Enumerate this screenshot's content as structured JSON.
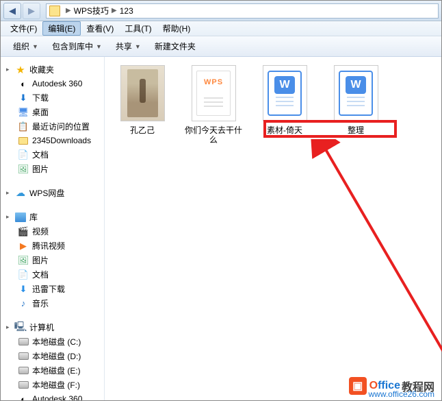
{
  "breadcrumb": {
    "part1": "WPS技巧",
    "part2": "123"
  },
  "menu": {
    "file": "文件(F)",
    "edit": "编辑(E)",
    "view": "查看(V)",
    "tools": "工具(T)",
    "help": "帮助(H)"
  },
  "toolbar": {
    "organize": "组织",
    "include": "包含到库中",
    "share": "共享",
    "newfolder": "新建文件夹"
  },
  "sidebar": {
    "favorites": {
      "label": "收藏夹",
      "items": [
        {
          "label": "Autodesk 360",
          "icon": "autodesk"
        },
        {
          "label": "下载",
          "icon": "download"
        },
        {
          "label": "桌面",
          "icon": "desktop"
        },
        {
          "label": "最近访问的位置",
          "icon": "recent"
        },
        {
          "label": "2345Downloads",
          "icon": "folder"
        },
        {
          "label": "文档",
          "icon": "document"
        },
        {
          "label": "图片",
          "icon": "picture"
        }
      ]
    },
    "wps": {
      "label": "WPS网盘"
    },
    "libraries": {
      "label": "库",
      "items": [
        {
          "label": "视频",
          "icon": "video"
        },
        {
          "label": "腾讯视频",
          "icon": "txvideo"
        },
        {
          "label": "图片",
          "icon": "picture"
        },
        {
          "label": "文档",
          "icon": "document"
        },
        {
          "label": "迅雷下载",
          "icon": "xunlei"
        },
        {
          "label": "音乐",
          "icon": "music"
        }
      ]
    },
    "computer": {
      "label": "计算机",
      "items": [
        {
          "label": "本地磁盘 (C:)"
        },
        {
          "label": "本地磁盘 (D:)"
        },
        {
          "label": "本地磁盘 (E:)"
        },
        {
          "label": "本地磁盘 (F:)"
        },
        {
          "label": "Autodesk 360"
        }
      ]
    }
  },
  "files": [
    {
      "name": "孔乙己",
      "type": "image"
    },
    {
      "name": "你们今天去干什么",
      "type": "wps"
    },
    {
      "name": "素材-倚天",
      "type": "doc"
    },
    {
      "name": "整理",
      "type": "doc"
    }
  ],
  "watermark": {
    "brand1": "Office",
    "brand2": "教程网",
    "url": "www.office26.com"
  }
}
